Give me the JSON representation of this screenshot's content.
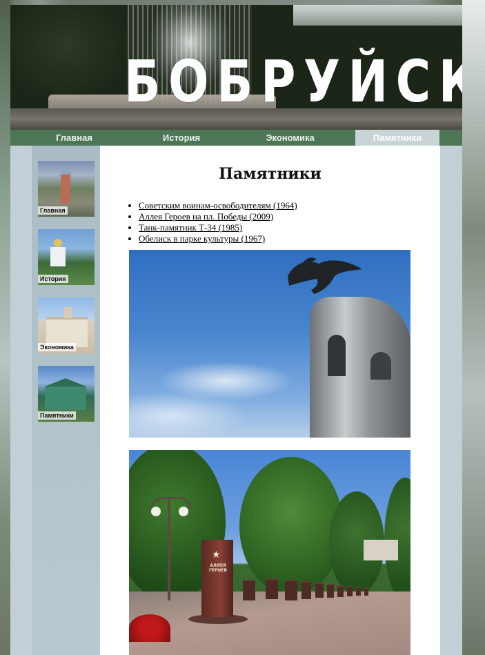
{
  "site": {
    "title": "БОБРУЙСК"
  },
  "nav": {
    "items": [
      {
        "label": "Главная"
      },
      {
        "label": "История"
      },
      {
        "label": "Экономика"
      },
      {
        "label": "Памятники",
        "active": true
      }
    ]
  },
  "sidebar": {
    "thumbnails": [
      {
        "caption": "Главная"
      },
      {
        "caption": "История"
      },
      {
        "caption": "Экономика"
      },
      {
        "caption": "Памятники"
      }
    ]
  },
  "main": {
    "heading": "Памятники",
    "links": [
      {
        "text": "Советским воинам-освободителям (1964)"
      },
      {
        "text": "Аллея Героев на пл. Победы (2009)"
      },
      {
        "text": "Танк-памятник Т-34 (1985)"
      },
      {
        "text": "Обелиск в парке культуры (1967)"
      }
    ],
    "photo2_sign": "АЛЛЕЯ ГЕРОЕВ"
  },
  "colors": {
    "nav_bg": "#4d7656",
    "nav_active_bg": "#c8d4d6",
    "sidebar_bg": "#b9c9cf",
    "content_bg": "#ffffff"
  }
}
